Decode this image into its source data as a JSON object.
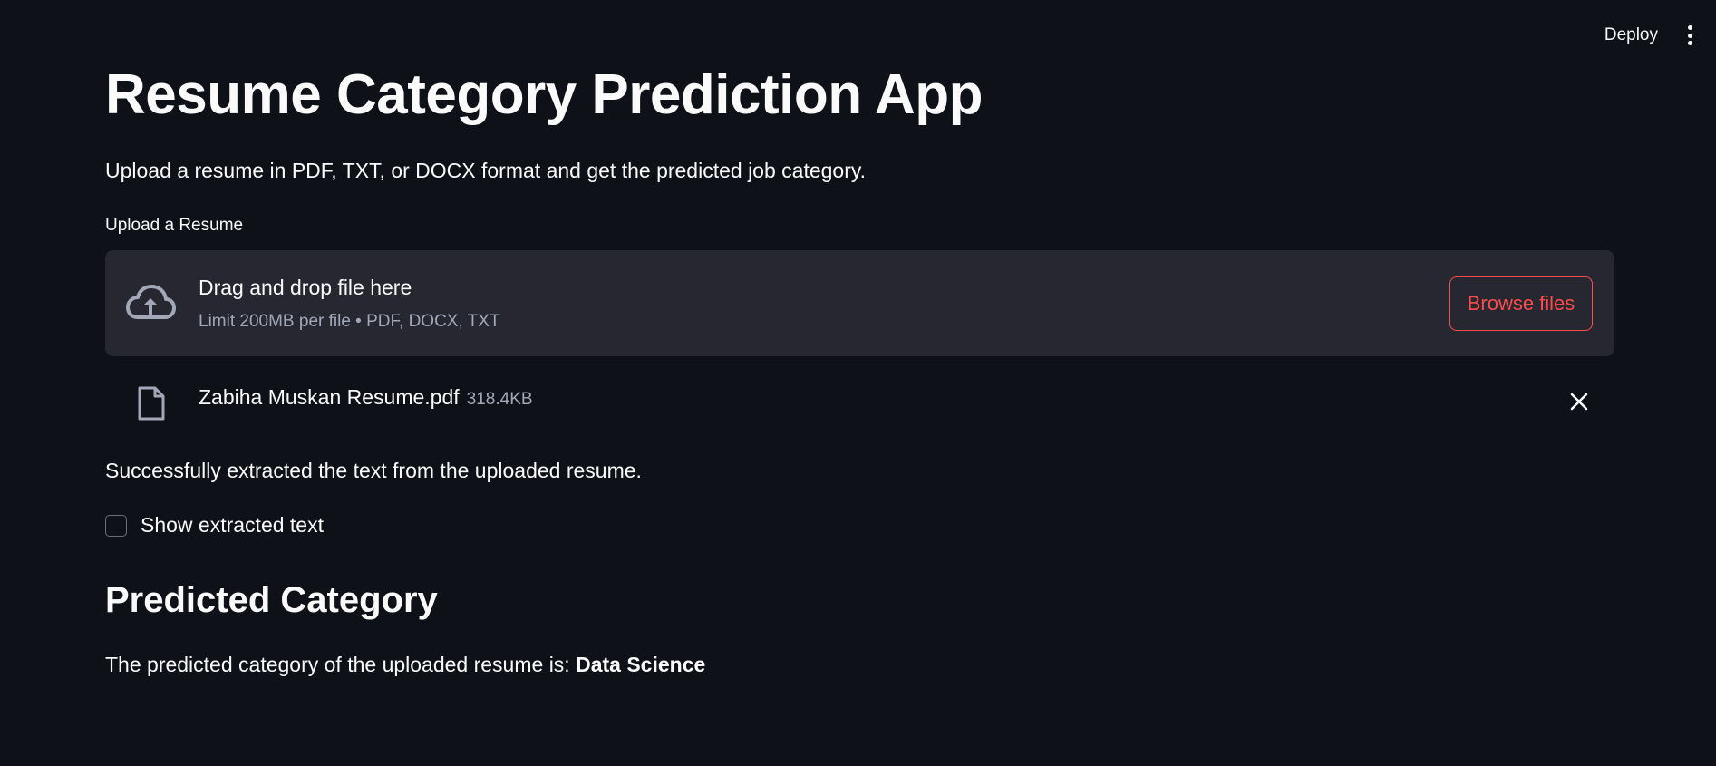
{
  "header": {
    "deploy_label": "Deploy",
    "menu_icon": "kebab-menu-icon"
  },
  "main": {
    "title": "Resume Category Prediction App",
    "subtitle": "Upload a resume in PDF, TXT, or DOCX format and get the predicted job category.",
    "uploader": {
      "label": "Upload a Resume",
      "drop_text": "Drag and drop file here",
      "limit_text": "Limit 200MB per file • PDF, DOCX, TXT",
      "browse_label": "Browse files",
      "icon": "cloud-upload-icon"
    },
    "uploaded_file": {
      "name": "Zabiha Muskan Resume.pdf",
      "size": "318.4KB",
      "icon": "file-icon",
      "remove_icon": "close-icon"
    },
    "success_message": "Successfully extracted the text from the uploaded resume.",
    "show_text_checkbox": {
      "label": "Show extracted text",
      "checked": false
    },
    "prediction": {
      "heading": "Predicted Category",
      "prefix": "The predicted category of the uploaded resume is: ",
      "value": "Data Science"
    }
  },
  "colors": {
    "background": "#0e1117",
    "text": "#fafafa",
    "dropzone_bg": "#262730",
    "accent": "#ff4b4b",
    "muted_text": "#a3a8b8"
  }
}
